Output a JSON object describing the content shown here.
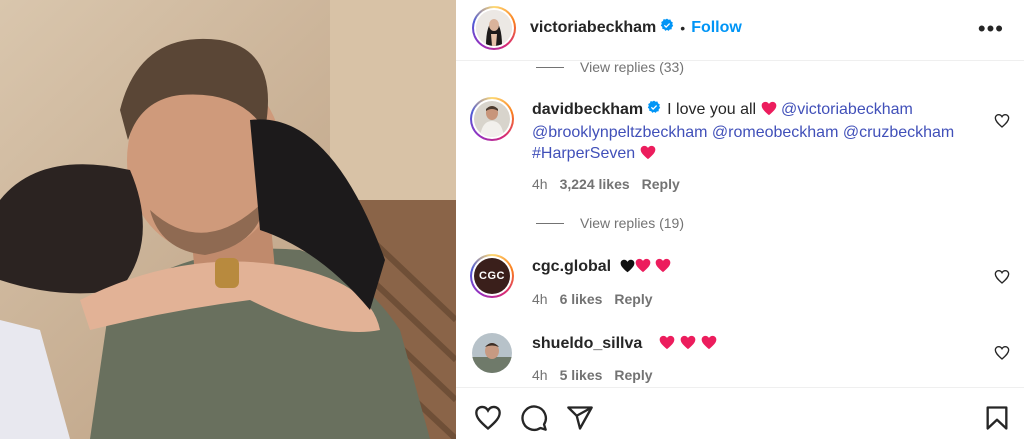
{
  "post_author": {
    "username": "victoriabeckham",
    "follow_label": "Follow",
    "separator": "•"
  },
  "more_label": "•••",
  "thread_top": {
    "view_replies": "View replies (33)"
  },
  "comments": [
    {
      "username": "davidbeckham",
      "verified": true,
      "text": "I love you all",
      "mentions": [
        "@victoriabeckham",
        "@brooklynpeltzbeckham",
        "@romeobeckham",
        "@cruzbeckham",
        "#HarperSeven"
      ],
      "time": "4h",
      "likes": "3,224 likes",
      "reply": "Reply",
      "view_replies": "View replies (19)"
    },
    {
      "username": "cgc.global",
      "avatar_text": "CGC",
      "time": "4h",
      "likes": "6 likes",
      "reply": "Reply"
    },
    {
      "username": "shueldo_sillva",
      "time": "4h",
      "likes": "5 likes",
      "reply": "Reply"
    }
  ],
  "colors": {
    "accent": "#0095f6",
    "mention": "#4150b9",
    "heart": "#ec1d5d"
  }
}
